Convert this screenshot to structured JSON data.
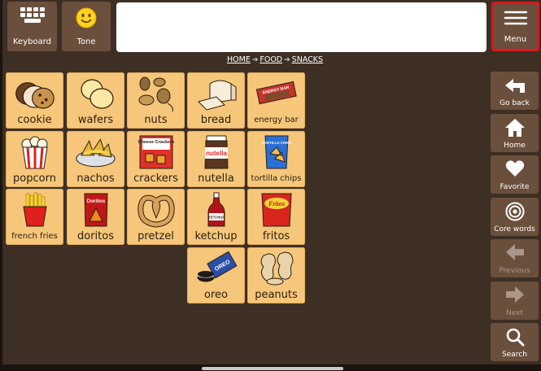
{
  "toolbar": {
    "keyboard_label": "Keyboard",
    "tone_label": "Tone",
    "menu_label": "Menu"
  },
  "message": {
    "text": ""
  },
  "breadcrumb": [
    "HOME",
    "FOOD",
    "SNACKS"
  ],
  "tiles": [
    {
      "label": "cookie",
      "icon": "cookie-icon"
    },
    {
      "label": "wafers",
      "icon": "wafers-icon"
    },
    {
      "label": "nuts",
      "icon": "nuts-icon"
    },
    {
      "label": "bread",
      "icon": "bread-icon"
    },
    {
      "label": "energy bar",
      "icon": "energy-bar-icon",
      "pic_text": "ENERGY BAR"
    },
    {
      "label": "popcorn",
      "icon": "popcorn-icon"
    },
    {
      "label": "nachos",
      "icon": "nachos-icon"
    },
    {
      "label": "crackers",
      "icon": "crackers-icon",
      "pic_text": "Cheese Crackers"
    },
    {
      "label": "nutella",
      "icon": "nutella-icon",
      "pic_text": "nutella"
    },
    {
      "label": "tortilla chips",
      "icon": "tortilla-chips-icon",
      "pic_text": "TORTILLA CHIPS"
    },
    {
      "label": "french fries",
      "icon": "french-fries-icon"
    },
    {
      "label": "doritos",
      "icon": "doritos-icon",
      "pic_text": "Doritos"
    },
    {
      "label": "pretzel",
      "icon": "pretzel-icon"
    },
    {
      "label": "ketchup",
      "icon": "ketchup-icon",
      "pic_text": "KETCHUP"
    },
    {
      "label": "fritos",
      "icon": "fritos-icon",
      "pic_text": "Fritos"
    },
    {
      "label": "oreo",
      "icon": "oreo-icon",
      "pic_text": "OREO"
    },
    {
      "label": "peanuts",
      "icon": "peanuts-icon"
    }
  ],
  "sidebar": [
    {
      "label": "Go back",
      "icon": "go-back-icon",
      "enabled": true
    },
    {
      "label": "Home",
      "icon": "home-icon",
      "enabled": true
    },
    {
      "label": "Favorite",
      "icon": "heart-icon",
      "enabled": true
    },
    {
      "label": "Core words",
      "icon": "target-icon",
      "enabled": true
    },
    {
      "label": "Previous",
      "icon": "arrow-left-icon",
      "enabled": false
    },
    {
      "label": "Next",
      "icon": "arrow-right-icon",
      "enabled": false
    },
    {
      "label": "Search",
      "icon": "search-icon",
      "enabled": true
    }
  ],
  "colors": {
    "background": "#3d2f24",
    "button": "#6a4f3c",
    "tile": "#f6c77a",
    "menu_highlight": "#e0141c"
  }
}
